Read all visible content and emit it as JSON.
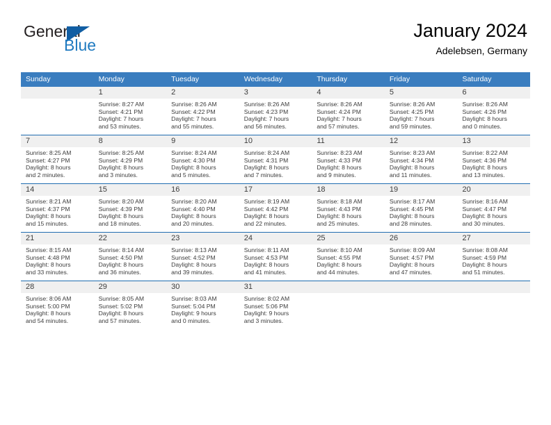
{
  "brand": {
    "name_top": "General",
    "name_bottom": "Blue",
    "triangle_icon": "triangle-icon",
    "accent_color": "#1f7ac0",
    "dark_color": "#231f20"
  },
  "header": {
    "title": "January 2024",
    "location": "Adelebsen, Germany"
  },
  "calendar": {
    "header_bg": "#3a7dbf",
    "row_divider_color": "#1f6cb0",
    "daynum_band_color": "#f0f0f0",
    "weekdays": [
      "Sunday",
      "Monday",
      "Tuesday",
      "Wednesday",
      "Thursday",
      "Friday",
      "Saturday"
    ],
    "weeks": [
      [
        {
          "day": ""
        },
        {
          "day": "1",
          "sunrise": "Sunrise: 8:27 AM",
          "sunset": "Sunset: 4:21 PM",
          "daylight_line1": "Daylight: 7 hours",
          "daylight_line2": "and 53 minutes."
        },
        {
          "day": "2",
          "sunrise": "Sunrise: 8:26 AM",
          "sunset": "Sunset: 4:22 PM",
          "daylight_line1": "Daylight: 7 hours",
          "daylight_line2": "and 55 minutes."
        },
        {
          "day": "3",
          "sunrise": "Sunrise: 8:26 AM",
          "sunset": "Sunset: 4:23 PM",
          "daylight_line1": "Daylight: 7 hours",
          "daylight_line2": "and 56 minutes."
        },
        {
          "day": "4",
          "sunrise": "Sunrise: 8:26 AM",
          "sunset": "Sunset: 4:24 PM",
          "daylight_line1": "Daylight: 7 hours",
          "daylight_line2": "and 57 minutes."
        },
        {
          "day": "5",
          "sunrise": "Sunrise: 8:26 AM",
          "sunset": "Sunset: 4:25 PM",
          "daylight_line1": "Daylight: 7 hours",
          "daylight_line2": "and 59 minutes."
        },
        {
          "day": "6",
          "sunrise": "Sunrise: 8:26 AM",
          "sunset": "Sunset: 4:26 PM",
          "daylight_line1": "Daylight: 8 hours",
          "daylight_line2": "and 0 minutes."
        }
      ],
      [
        {
          "day": "7",
          "sunrise": "Sunrise: 8:25 AM",
          "sunset": "Sunset: 4:27 PM",
          "daylight_line1": "Daylight: 8 hours",
          "daylight_line2": "and 2 minutes."
        },
        {
          "day": "8",
          "sunrise": "Sunrise: 8:25 AM",
          "sunset": "Sunset: 4:29 PM",
          "daylight_line1": "Daylight: 8 hours",
          "daylight_line2": "and 3 minutes."
        },
        {
          "day": "9",
          "sunrise": "Sunrise: 8:24 AM",
          "sunset": "Sunset: 4:30 PM",
          "daylight_line1": "Daylight: 8 hours",
          "daylight_line2": "and 5 minutes."
        },
        {
          "day": "10",
          "sunrise": "Sunrise: 8:24 AM",
          "sunset": "Sunset: 4:31 PM",
          "daylight_line1": "Daylight: 8 hours",
          "daylight_line2": "and 7 minutes."
        },
        {
          "day": "11",
          "sunrise": "Sunrise: 8:23 AM",
          "sunset": "Sunset: 4:33 PM",
          "daylight_line1": "Daylight: 8 hours",
          "daylight_line2": "and 9 minutes."
        },
        {
          "day": "12",
          "sunrise": "Sunrise: 8:23 AM",
          "sunset": "Sunset: 4:34 PM",
          "daylight_line1": "Daylight: 8 hours",
          "daylight_line2": "and 11 minutes."
        },
        {
          "day": "13",
          "sunrise": "Sunrise: 8:22 AM",
          "sunset": "Sunset: 4:36 PM",
          "daylight_line1": "Daylight: 8 hours",
          "daylight_line2": "and 13 minutes."
        }
      ],
      [
        {
          "day": "14",
          "sunrise": "Sunrise: 8:21 AM",
          "sunset": "Sunset: 4:37 PM",
          "daylight_line1": "Daylight: 8 hours",
          "daylight_line2": "and 15 minutes."
        },
        {
          "day": "15",
          "sunrise": "Sunrise: 8:20 AM",
          "sunset": "Sunset: 4:39 PM",
          "daylight_line1": "Daylight: 8 hours",
          "daylight_line2": "and 18 minutes."
        },
        {
          "day": "16",
          "sunrise": "Sunrise: 8:20 AM",
          "sunset": "Sunset: 4:40 PM",
          "daylight_line1": "Daylight: 8 hours",
          "daylight_line2": "and 20 minutes."
        },
        {
          "day": "17",
          "sunrise": "Sunrise: 8:19 AM",
          "sunset": "Sunset: 4:42 PM",
          "daylight_line1": "Daylight: 8 hours",
          "daylight_line2": "and 22 minutes."
        },
        {
          "day": "18",
          "sunrise": "Sunrise: 8:18 AM",
          "sunset": "Sunset: 4:43 PM",
          "daylight_line1": "Daylight: 8 hours",
          "daylight_line2": "and 25 minutes."
        },
        {
          "day": "19",
          "sunrise": "Sunrise: 8:17 AM",
          "sunset": "Sunset: 4:45 PM",
          "daylight_line1": "Daylight: 8 hours",
          "daylight_line2": "and 28 minutes."
        },
        {
          "day": "20",
          "sunrise": "Sunrise: 8:16 AM",
          "sunset": "Sunset: 4:47 PM",
          "daylight_line1": "Daylight: 8 hours",
          "daylight_line2": "and 30 minutes."
        }
      ],
      [
        {
          "day": "21",
          "sunrise": "Sunrise: 8:15 AM",
          "sunset": "Sunset: 4:48 PM",
          "daylight_line1": "Daylight: 8 hours",
          "daylight_line2": "and 33 minutes."
        },
        {
          "day": "22",
          "sunrise": "Sunrise: 8:14 AM",
          "sunset": "Sunset: 4:50 PM",
          "daylight_line1": "Daylight: 8 hours",
          "daylight_line2": "and 36 minutes."
        },
        {
          "day": "23",
          "sunrise": "Sunrise: 8:13 AM",
          "sunset": "Sunset: 4:52 PM",
          "daylight_line1": "Daylight: 8 hours",
          "daylight_line2": "and 39 minutes."
        },
        {
          "day": "24",
          "sunrise": "Sunrise: 8:11 AM",
          "sunset": "Sunset: 4:53 PM",
          "daylight_line1": "Daylight: 8 hours",
          "daylight_line2": "and 41 minutes."
        },
        {
          "day": "25",
          "sunrise": "Sunrise: 8:10 AM",
          "sunset": "Sunset: 4:55 PM",
          "daylight_line1": "Daylight: 8 hours",
          "daylight_line2": "and 44 minutes."
        },
        {
          "day": "26",
          "sunrise": "Sunrise: 8:09 AM",
          "sunset": "Sunset: 4:57 PM",
          "daylight_line1": "Daylight: 8 hours",
          "daylight_line2": "and 47 minutes."
        },
        {
          "day": "27",
          "sunrise": "Sunrise: 8:08 AM",
          "sunset": "Sunset: 4:59 PM",
          "daylight_line1": "Daylight: 8 hours",
          "daylight_line2": "and 51 minutes."
        }
      ],
      [
        {
          "day": "28",
          "sunrise": "Sunrise: 8:06 AM",
          "sunset": "Sunset: 5:00 PM",
          "daylight_line1": "Daylight: 8 hours",
          "daylight_line2": "and 54 minutes."
        },
        {
          "day": "29",
          "sunrise": "Sunrise: 8:05 AM",
          "sunset": "Sunset: 5:02 PM",
          "daylight_line1": "Daylight: 8 hours",
          "daylight_line2": "and 57 minutes."
        },
        {
          "day": "30",
          "sunrise": "Sunrise: 8:03 AM",
          "sunset": "Sunset: 5:04 PM",
          "daylight_line1": "Daylight: 9 hours",
          "daylight_line2": "and 0 minutes."
        },
        {
          "day": "31",
          "sunrise": "Sunrise: 8:02 AM",
          "sunset": "Sunset: 5:06 PM",
          "daylight_line1": "Daylight: 9 hours",
          "daylight_line2": "and 3 minutes."
        },
        {
          "day": ""
        },
        {
          "day": ""
        },
        {
          "day": ""
        }
      ]
    ]
  }
}
